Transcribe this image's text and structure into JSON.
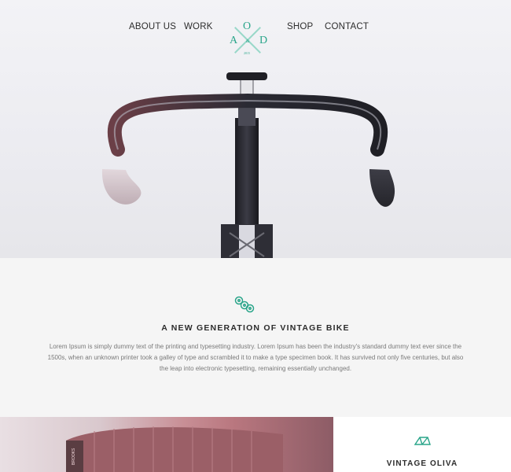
{
  "nav": {
    "about_label": "ABOUT US",
    "work_label": "WORK",
    "shop_label": "SHOP",
    "contact_label": "CONTACT",
    "logo": {
      "letter_top": "O",
      "letter_left": "A",
      "letter_right": "D",
      "ampersand": "&",
      "tagline": "2015"
    }
  },
  "intro": {
    "icon": "bike-chain-icon",
    "title": "A NEW GENERATION OF VINTAGE BIKE",
    "text": "Lorem Ipsum is simply dummy text of the printing and typesetting industry. Lorem Ipsum has been the industry's standard dummy text ever since the 1500s, when an unknown printer took a galley of type and scrambled it to make a type specimen book. It has survived not only five centuries, but also the leap into electronic typesetting, remaining essentially unchanged."
  },
  "feature": {
    "icon": "bike-frame-icon",
    "title": "VINTAGE OLIVA",
    "photo_label": "BROOKS"
  },
  "colors": {
    "accent": "#2aa58a",
    "text_dark": "#2c2c2c",
    "text_muted": "#7a7a7a"
  }
}
